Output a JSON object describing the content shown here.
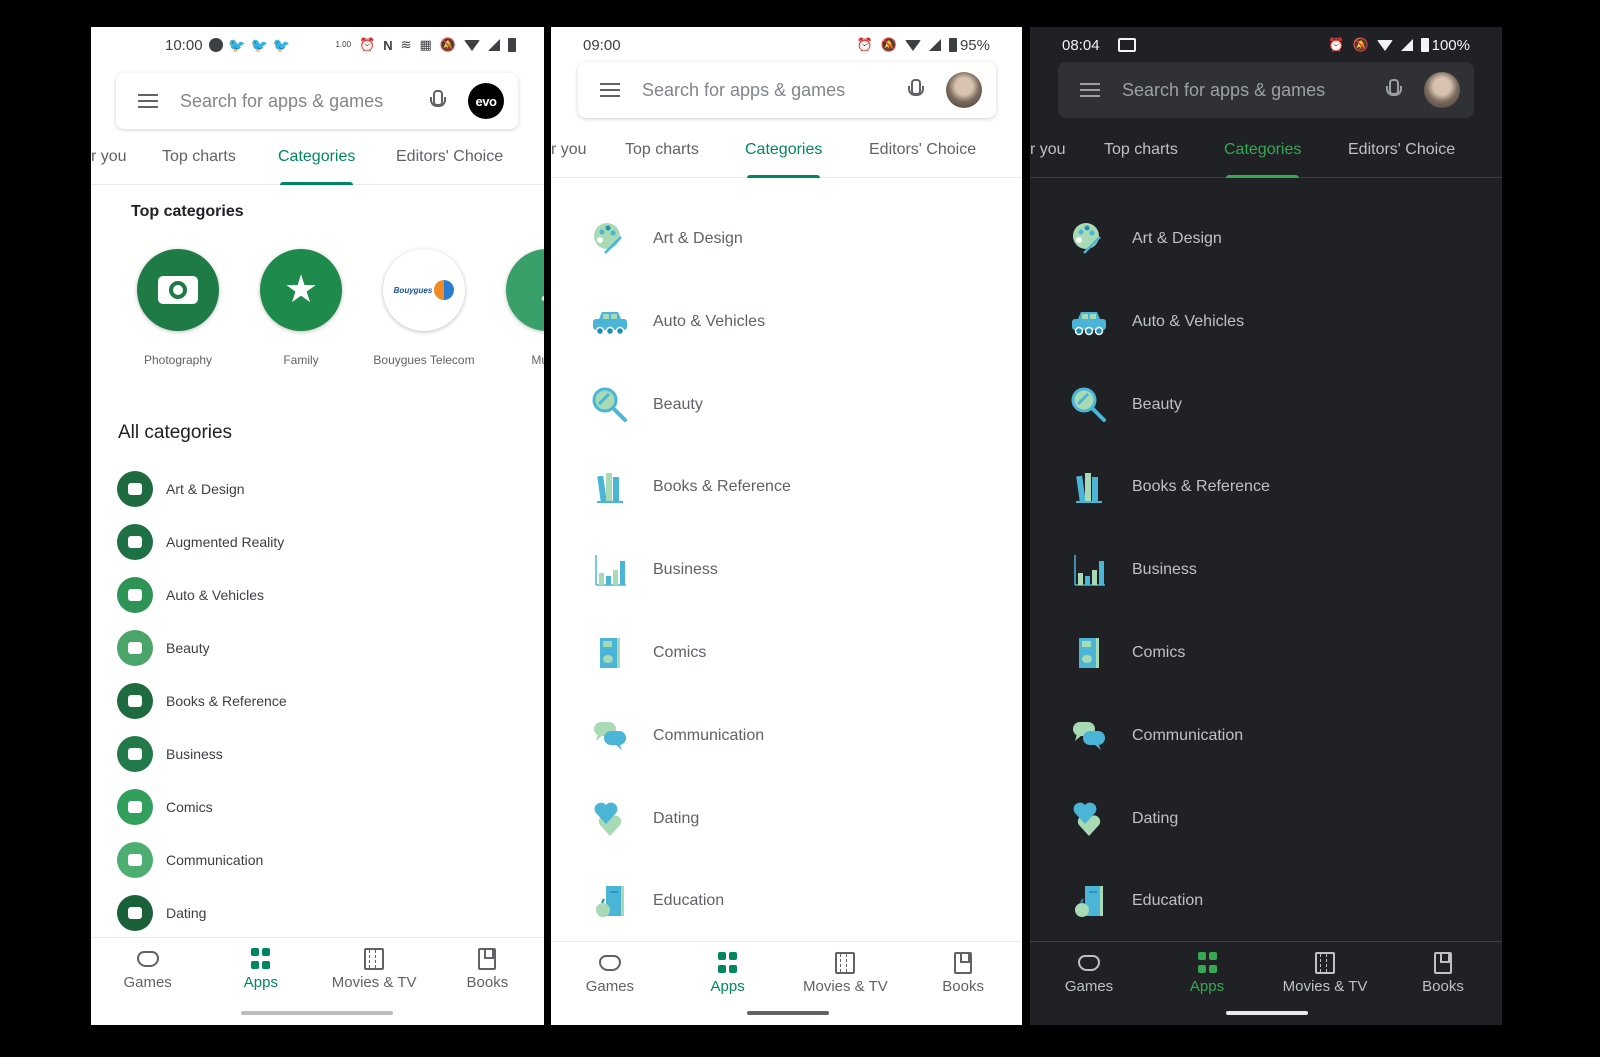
{
  "colors": {
    "accent_light": "#01875f",
    "accent_dark": "#34a853",
    "dark_bg": "#202124"
  },
  "search": {
    "placeholder": "Search for apps & games"
  },
  "tabs": [
    {
      "label": "r you"
    },
    {
      "label": "Top charts"
    },
    {
      "label": "Categories",
      "active": true
    },
    {
      "label": "Editors' Choice"
    }
  ],
  "bottom_nav": [
    {
      "label": "Games",
      "icon": "gamepad-icon"
    },
    {
      "label": "Apps",
      "icon": "apps-grid-icon",
      "active": true
    },
    {
      "label": "Movies & TV",
      "icon": "film-icon"
    },
    {
      "label": "Books",
      "icon": "bookmark-book-icon"
    }
  ],
  "phone1": {
    "status": {
      "time": "10:00",
      "speed": "1.00"
    },
    "avatar_text": "evo",
    "top_categories_title": "Top categories",
    "top_categories": [
      {
        "label": "Photography",
        "icon": "camera-icon"
      },
      {
        "label": "Family",
        "icon": "star-face-icon"
      },
      {
        "label": "Bouygues Telecom",
        "icon": "bouygues-logo-icon",
        "logo_text": "Bouygues"
      },
      {
        "label": "Music",
        "icon": "music-note-icon"
      }
    ],
    "all_categories_title": "All categories",
    "categories": [
      {
        "label": "Art & Design"
      },
      {
        "label": "Augmented Reality"
      },
      {
        "label": "Auto & Vehicles"
      },
      {
        "label": "Beauty"
      },
      {
        "label": "Books & Reference"
      },
      {
        "label": "Business"
      },
      {
        "label": "Comics"
      },
      {
        "label": "Communication"
      },
      {
        "label": "Dating"
      }
    ]
  },
  "phone2": {
    "status": {
      "time": "09:00",
      "battery": "95%"
    }
  },
  "phone3": {
    "status": {
      "time": "08:04",
      "battery": "100%"
    }
  },
  "categories": [
    {
      "label": "Art & Design",
      "icon": "palette-icon"
    },
    {
      "label": "Auto & Vehicles",
      "icon": "car-icon"
    },
    {
      "label": "Beauty",
      "icon": "hand-mirror-icon"
    },
    {
      "label": "Books & Reference",
      "icon": "books-icon"
    },
    {
      "label": "Business",
      "icon": "bar-chart-icon"
    },
    {
      "label": "Comics",
      "icon": "comic-book-icon"
    },
    {
      "label": "Communication",
      "icon": "chat-bubbles-icon"
    },
    {
      "label": "Dating",
      "icon": "hearts-icon"
    },
    {
      "label": "Education",
      "icon": "book-apple-icon"
    }
  ]
}
